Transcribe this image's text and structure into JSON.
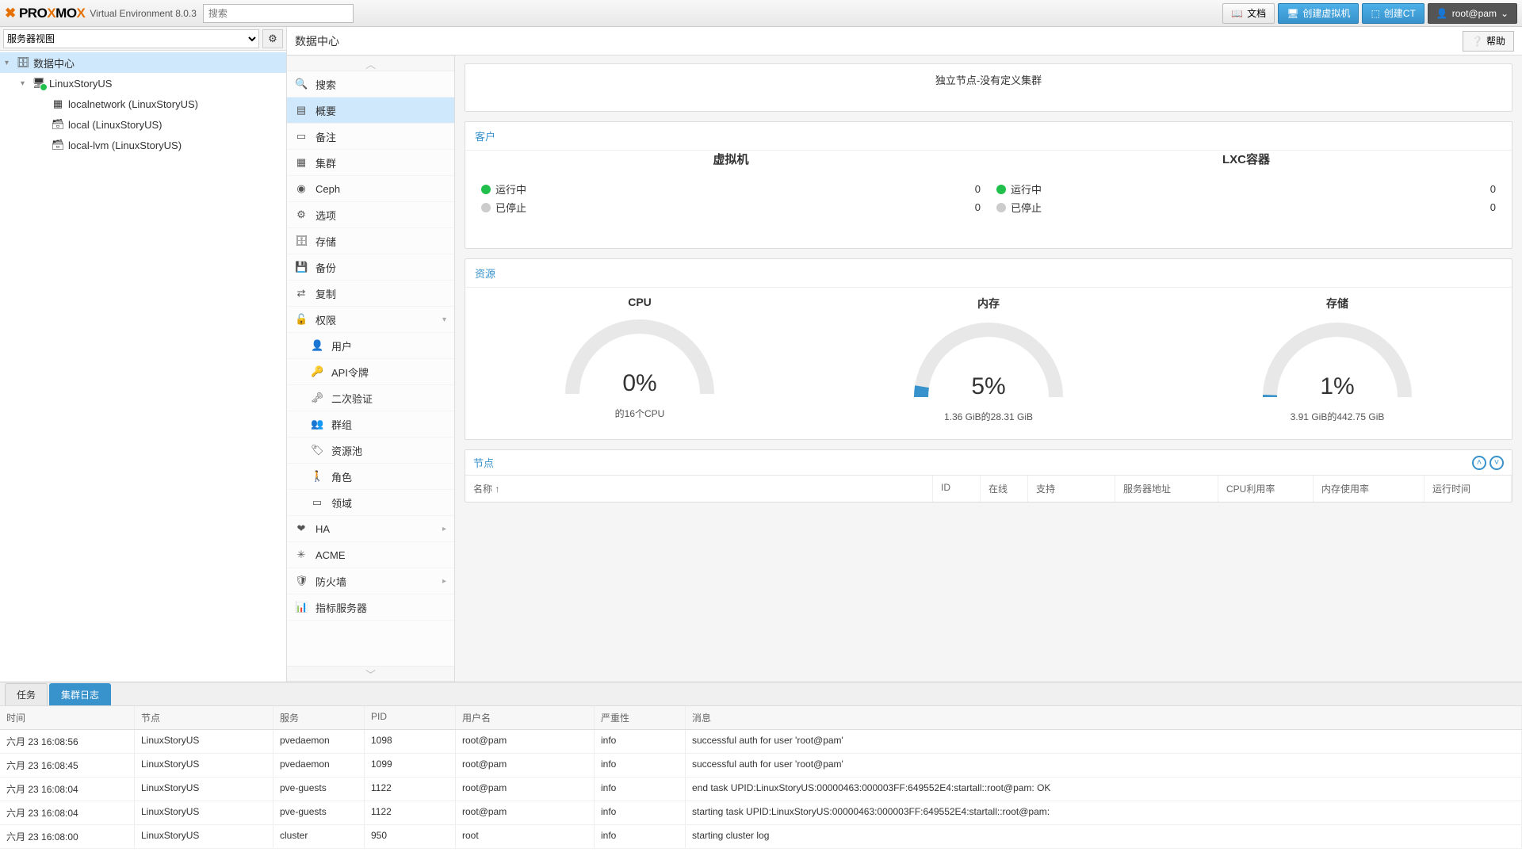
{
  "app": {
    "version": "Virtual Environment 8.0.3",
    "search_placeholder": "搜索"
  },
  "topbar": {
    "docs": "文档",
    "create_vm": "创建虚拟机",
    "create_ct": "创建CT",
    "user": "root@pam"
  },
  "view_selector": {
    "label": "服务器视图"
  },
  "tree": {
    "root": "数据中心",
    "node": "LinuxStoryUS",
    "items": [
      "localnetwork (LinuxStoryUS)",
      "local (LinuxStoryUS)",
      "local-lvm (LinuxStoryUS)"
    ]
  },
  "breadcrumb": "数据中心",
  "help": "帮助",
  "menu": {
    "search": "搜索",
    "summary": "概要",
    "notes": "备注",
    "cluster": "集群",
    "ceph": "Ceph",
    "options": "选项",
    "storage": "存储",
    "backup": "备份",
    "replication": "复制",
    "permissions": "权限",
    "perm_users": "用户",
    "perm_tokens": "API令牌",
    "perm_2fa": "二次验证",
    "perm_groups": "群组",
    "perm_pools": "资源池",
    "perm_roles": "角色",
    "perm_realms": "领域",
    "ha": "HA",
    "acme": "ACME",
    "firewall": "防火墙",
    "metrics": "指标服务器"
  },
  "standalone_text": "独立节点-没有定义集群",
  "guests": {
    "title": "客户",
    "vm_title": "虚拟机",
    "lxc_title": "LXC容器",
    "running": "运行中",
    "stopped": "已停止",
    "vm_running": "0",
    "vm_stopped": "0",
    "lxc_running": "0",
    "lxc_stopped": "0"
  },
  "resources": {
    "title": "资源",
    "cpu": {
      "title": "CPU",
      "pct": "0%",
      "sub": "的16个CPU",
      "val": 0
    },
    "mem": {
      "title": "内存",
      "pct": "5%",
      "sub": "1.36 GiB的28.31 GiB",
      "val": 5
    },
    "storage": {
      "title": "存储",
      "pct": "1%",
      "sub": "3.91 GiB的442.75 GiB",
      "val": 1
    }
  },
  "nodes": {
    "title": "节点",
    "cols": {
      "name": "名称 ↑",
      "id": "ID",
      "online": "在线",
      "support": "支持",
      "addr": "服务器地址",
      "cpu": "CPU利用率",
      "mem": "内存使用率",
      "uptime": "运行时间"
    }
  },
  "log": {
    "tab_tasks": "任务",
    "tab_cluster": "集群日志",
    "cols": {
      "time": "时间",
      "node": "节点",
      "service": "服务",
      "pid": "PID",
      "user": "用户名",
      "sev": "严重性",
      "msg": "消息"
    },
    "rows": [
      {
        "time": "六月 23 16:08:56",
        "node": "LinuxStoryUS",
        "svc": "pvedaemon",
        "pid": "1098",
        "user": "root@pam",
        "sev": "info",
        "msg": "successful auth for user 'root@pam'"
      },
      {
        "time": "六月 23 16:08:45",
        "node": "LinuxStoryUS",
        "svc": "pvedaemon",
        "pid": "1099",
        "user": "root@pam",
        "sev": "info",
        "msg": "successful auth for user 'root@pam'"
      },
      {
        "time": "六月 23 16:08:04",
        "node": "LinuxStoryUS",
        "svc": "pve-guests",
        "pid": "1122",
        "user": "root@pam",
        "sev": "info",
        "msg": "end task UPID:LinuxStoryUS:00000463:000003FF:649552E4:startall::root@pam: OK"
      },
      {
        "time": "六月 23 16:08:04",
        "node": "LinuxStoryUS",
        "svc": "pve-guests",
        "pid": "1122",
        "user": "root@pam",
        "sev": "info",
        "msg": "starting task UPID:LinuxStoryUS:00000463:000003FF:649552E4:startall::root@pam:"
      },
      {
        "time": "六月 23 16:08:00",
        "node": "LinuxStoryUS",
        "svc": "cluster",
        "pid": "950",
        "user": "root",
        "sev": "info",
        "msg": "starting cluster log"
      }
    ]
  },
  "chart_data": [
    {
      "type": "gauge",
      "title": "CPU",
      "value": 0,
      "max": 100,
      "unit": "%",
      "subtitle": "的16个CPU"
    },
    {
      "type": "gauge",
      "title": "内存",
      "value": 5,
      "max": 100,
      "unit": "%",
      "subtitle": "1.36 GiB的28.31 GiB"
    },
    {
      "type": "gauge",
      "title": "存储",
      "value": 1,
      "max": 100,
      "unit": "%",
      "subtitle": "3.91 GiB的442.75 GiB"
    }
  ]
}
